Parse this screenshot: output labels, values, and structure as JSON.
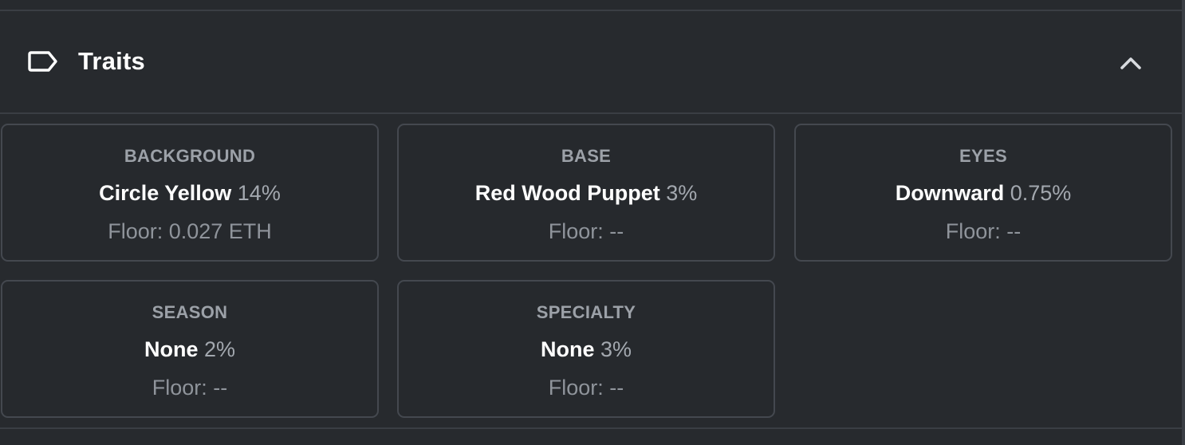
{
  "section": {
    "title": "Traits",
    "icon": "tag-icon",
    "toggle_icon": "chevron-up-icon"
  },
  "traits": [
    {
      "type": "BACKGROUND",
      "value": "Circle Yellow",
      "percent": "14%",
      "floor": "Floor: 0.027 ETH"
    },
    {
      "type": "BASE",
      "value": "Red Wood Puppet",
      "percent": "3%",
      "floor": "Floor: --"
    },
    {
      "type": "EYES",
      "value": "Downward",
      "percent": "0.75%",
      "floor": "Floor: --"
    },
    {
      "type": "SEASON",
      "value": "None",
      "percent": "2%",
      "floor": "Floor: --"
    },
    {
      "type": "SPECIALTY",
      "value": "None",
      "percent": "3%",
      "floor": "Floor: --"
    }
  ],
  "colors": {
    "background": "#272a2e",
    "card_border": "#44484f",
    "text_primary": "#ffffff",
    "text_secondary": "#9ca1a8"
  }
}
